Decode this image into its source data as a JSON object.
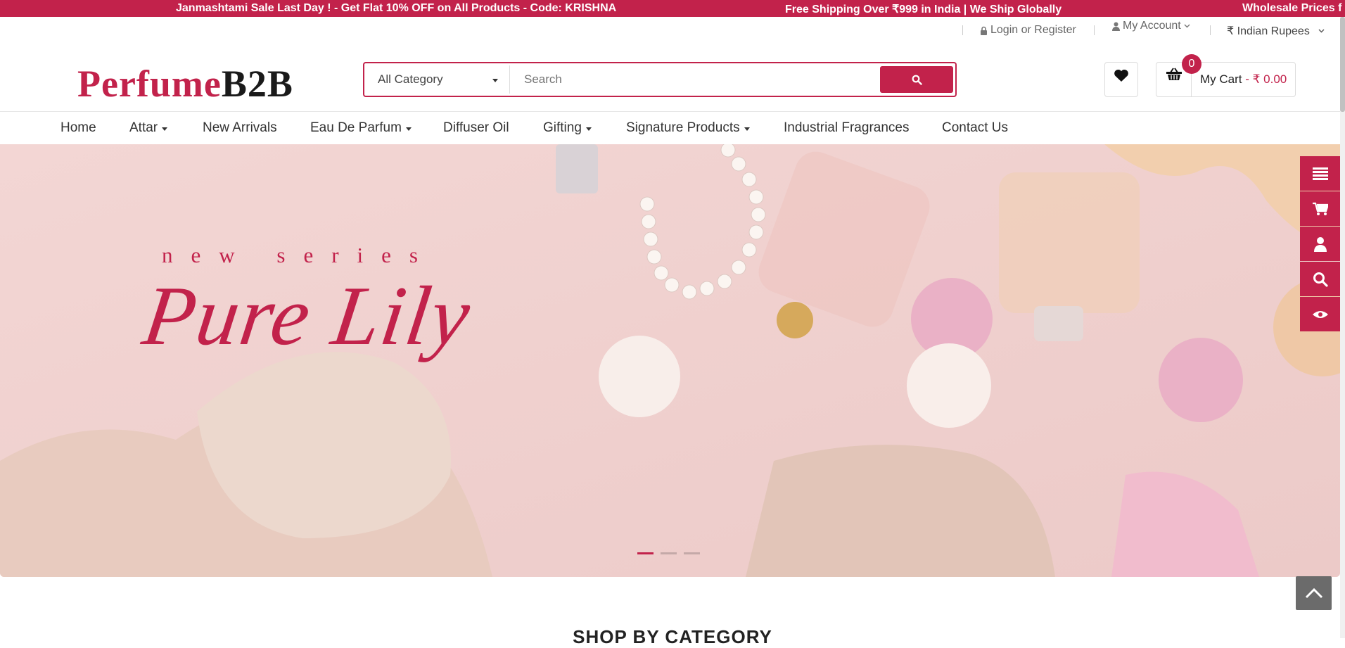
{
  "announcements": [
    "Janmashtami Sale Last Day ! - Get Flat 10% OFF on All Products - Code: KRISHNA",
    "Free Shipping Over ₹999 in India | We Ship Globally",
    "Wholesale Prices f"
  ],
  "util": {
    "login": "Login or Register",
    "account": "My Account",
    "currency": "₹ Indian Rupees"
  },
  "logo": {
    "part1": "Perfume",
    "part2": "B2B"
  },
  "search": {
    "category": "All Category",
    "placeholder": "Search"
  },
  "cart": {
    "count": "0",
    "label": "My Cart",
    "amount": "- ₹ 0.00"
  },
  "nav": [
    {
      "label": "Home"
    },
    {
      "label": "Attar"
    },
    {
      "label": "New Arrivals"
    },
    {
      "label": "Eau De Parfum"
    },
    {
      "label": "Diffuser Oil"
    },
    {
      "label": "Gifting"
    },
    {
      "label": "Signature Products"
    },
    {
      "label": "Industrial Fragrances"
    },
    {
      "label": "Contact Us"
    }
  ],
  "hero": {
    "tagline": "new series",
    "title": "Pure Lily",
    "slide_count": 3,
    "active_slide": 1
  },
  "section": {
    "title": "SHOP BY CATEGORY"
  },
  "colors": {
    "brand": "#c2224b",
    "hero_bg": "#f1d0cf"
  },
  "icons": [
    "lock-icon",
    "user-icon",
    "chevron-down-icon",
    "caret-down-icon",
    "search-icon",
    "heart-icon",
    "basket-icon",
    "menu-icon",
    "cart-icon",
    "eye-icon",
    "chevron-up-icon"
  ]
}
